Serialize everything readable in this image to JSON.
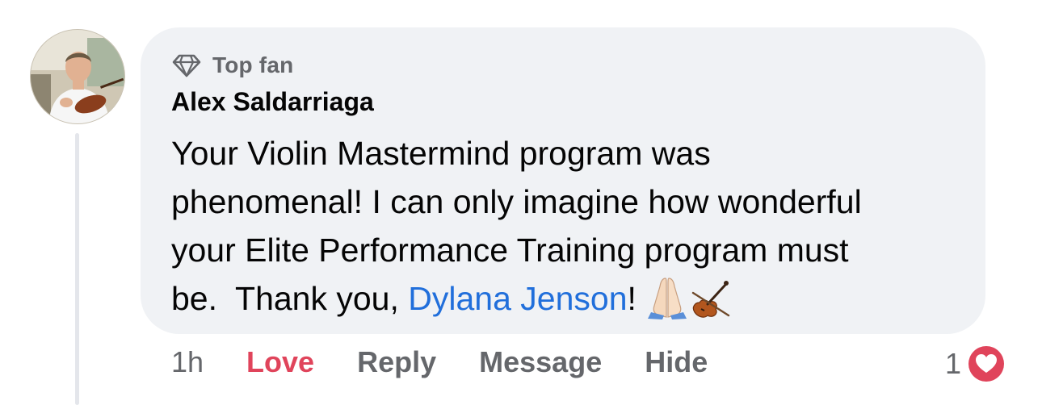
{
  "comment": {
    "badge_label": "Top fan",
    "badge_icon": "diamond-icon",
    "author": "Alex Saldarriaga",
    "body_lines": [
      "Your Violin Mastermind program was",
      "phenomenal!  I can only imagine how wonderful",
      "your Elite Performance Training program must"
    ],
    "last_line_prefix": "be.  Thank you, ",
    "mention": "Dylana Jenson",
    "last_line_suffix": "!",
    "emojis": [
      "folded-hands-icon",
      "violin-icon"
    ]
  },
  "actions": {
    "time": "1h",
    "love": "Love",
    "reply": "Reply",
    "message": "Message",
    "hide": "Hide"
  },
  "reactions": {
    "count": "1",
    "icon": "love-reaction-icon"
  },
  "colors": {
    "bubble": "#f0f2f5",
    "love": "#e0445b",
    "mention": "#216fdb",
    "secondary_text": "#65676b"
  }
}
